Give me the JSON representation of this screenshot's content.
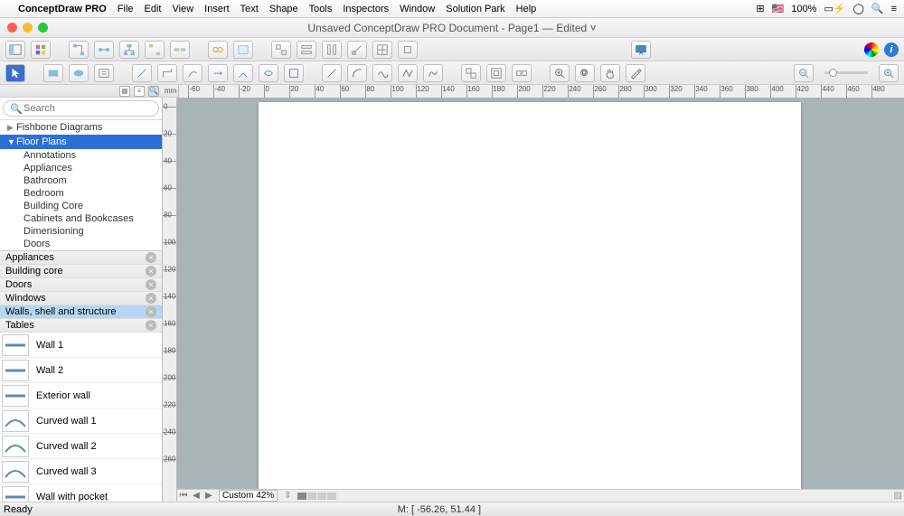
{
  "menubar": {
    "app": "ConceptDraw PRO",
    "items": [
      "File",
      "Edit",
      "View",
      "Insert",
      "Text",
      "Shape",
      "Tools",
      "Inspectors",
      "Window",
      "Solution Park",
      "Help"
    ],
    "battery": "100%"
  },
  "window": {
    "title": "Unsaved ConceptDraw PRO Document - Page1 — Edited ˅"
  },
  "sidebar": {
    "search_placeholder": "Search",
    "tree": {
      "fishbone": "Fishbone Diagrams",
      "floorplans": "Floor Plans",
      "floor_subs": [
        "Annotations",
        "Appliances",
        "Bathroom",
        "Bedroom",
        "Building Core",
        "Cabinets and Bookcases",
        "Dimensioning",
        "Doors"
      ]
    },
    "categories": [
      {
        "label": "Appliances",
        "sel": false
      },
      {
        "label": "Building core",
        "sel": false
      },
      {
        "label": "Doors",
        "sel": false
      },
      {
        "label": "Windows",
        "sel": false
      },
      {
        "label": "Walls, shell and structure",
        "sel": true
      },
      {
        "label": "Tables",
        "sel": false
      }
    ],
    "shapes": [
      {
        "label": "Wall 1",
        "curve": 0
      },
      {
        "label": "Wall 2",
        "curve": 0
      },
      {
        "label": "Exterior wall",
        "curve": 0
      },
      {
        "label": "Curved wall 1",
        "curve": 1
      },
      {
        "label": "Curved wall 2",
        "curve": 1
      },
      {
        "label": "Curved wall 3",
        "curve": 1
      },
      {
        "label": "Wall with pocket",
        "curve": 0
      }
    ]
  },
  "ruler": {
    "unit": "mm",
    "h_ticks": [
      -60,
      -40,
      -20,
      0,
      20,
      40,
      60,
      80,
      100,
      120,
      140,
      160,
      180,
      200,
      220,
      240,
      260,
      280,
      300,
      320,
      340,
      360,
      380,
      400,
      420,
      440,
      460,
      480
    ],
    "v_ticks": [
      0,
      20,
      40,
      60,
      80,
      100,
      120,
      140,
      160,
      180,
      200,
      220,
      240,
      260
    ]
  },
  "bottombar": {
    "zoom_label": "Custom 42%"
  },
  "status": {
    "ready": "Ready",
    "mouse": "M: [ -56.26, 51.44 ]"
  },
  "icons": {
    "apple": "",
    "grid": "⊞",
    "flag": "🇺🇸",
    "fullscreen": "⛶",
    "notif": "≡",
    "search": "🔍",
    "info": "i"
  }
}
